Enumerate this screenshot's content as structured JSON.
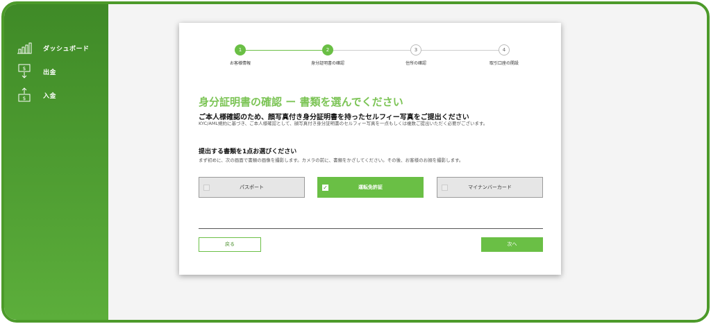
{
  "sidebar": {
    "items": [
      {
        "label": "ダッシュボード",
        "icon": "bar-chart-icon"
      },
      {
        "label": "出金",
        "icon": "withdraw-icon"
      },
      {
        "label": "入金",
        "icon": "deposit-icon"
      }
    ]
  },
  "stepper": {
    "steps": [
      {
        "number": "1",
        "label": "お客様情報",
        "state": "done"
      },
      {
        "number": "2",
        "label": "身分証明書の確認",
        "state": "current"
      },
      {
        "number": "3",
        "label": "住所の確認",
        "state": "todo"
      },
      {
        "number": "4",
        "label": "取引口座の開設",
        "state": "todo"
      }
    ]
  },
  "main": {
    "title": "身分証明書の確認 ー 書類を選んでください",
    "subtitle": "ご本人様確認のため、顔写真付き身分証明書を持ったセルフィー写真をご提出ください",
    "description": "KYC/AML規約に基づき、ご本人様確認として、顔写真付き身分証明書のセルフィー写真を一点もしくは複数ご提出いただく必要がございます。",
    "section_title": "提出する書類を1点お選びください",
    "section_description": "まず初めに、次の画面で書類の画像を撮影します。カメラの前に、書類をかざしてください。その後、お客様のお顔を撮影します。",
    "options": [
      {
        "label": "パスポート",
        "checked": false
      },
      {
        "label": "運転免許証",
        "checked": true
      },
      {
        "label": "マイナンバーカード",
        "checked": false
      }
    ],
    "back_label": "戻る",
    "next_label": "次へ"
  },
  "colors": {
    "accent": "#6abf45",
    "sidebar": "#4c9a2a",
    "frame_border": "#4c9a2a"
  }
}
